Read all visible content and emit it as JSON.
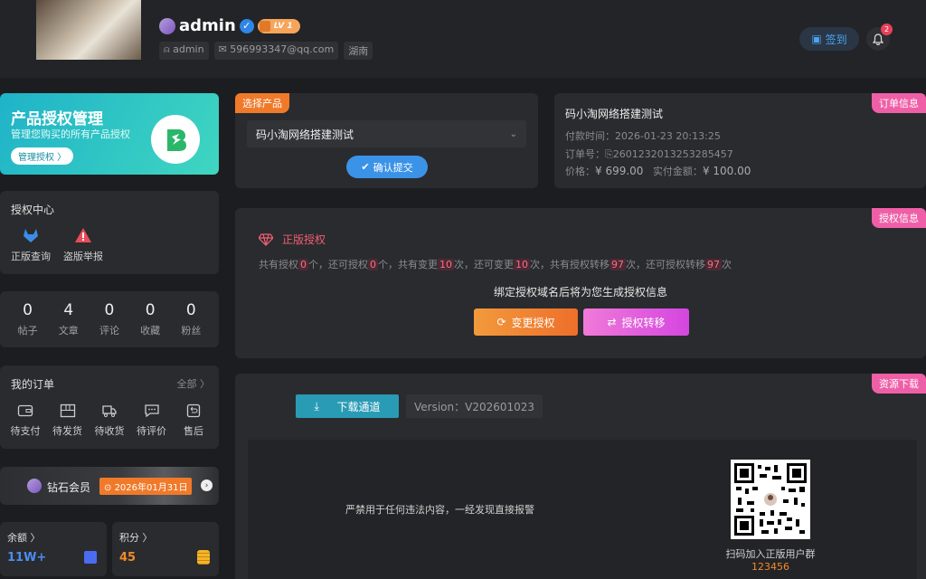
{
  "header": {
    "username": "admin",
    "level": "LV 1",
    "meta_user": "admin",
    "meta_email": "596993347@qq.com",
    "meta_region": "湖南",
    "signin_label": "签到",
    "notif_count": "2"
  },
  "promo": {
    "title": "产品授权管理",
    "subtitle": "管理您购买的所有产品授权",
    "button": "管理授权 〉"
  },
  "center": {
    "title": "授权中心",
    "items": [
      {
        "label": "正版查询",
        "icon": "gitlab-icon",
        "color": "#3b8de8"
      },
      {
        "label": "盗版举报",
        "icon": "warning-icon",
        "color": "#e84c5a"
      }
    ]
  },
  "stats": [
    {
      "value": "0",
      "label": "帖子"
    },
    {
      "value": "4",
      "label": "文章"
    },
    {
      "value": "0",
      "label": "评论"
    },
    {
      "value": "0",
      "label": "收藏"
    },
    {
      "value": "0",
      "label": "粉丝"
    }
  ],
  "orders": {
    "title": "我的订单",
    "all": "全部 〉",
    "items": [
      {
        "label": "待支付",
        "icon": "wallet-icon"
      },
      {
        "label": "待发货",
        "icon": "box-icon"
      },
      {
        "label": "待收货",
        "icon": "truck-icon"
      },
      {
        "label": "待评价",
        "icon": "chat-icon"
      },
      {
        "label": "售后",
        "icon": "return-icon"
      }
    ]
  },
  "vip": {
    "label": "钻石会员",
    "date": "2026年01月31日"
  },
  "balance": {
    "title": "余额 〉",
    "value": "11W+"
  },
  "points": {
    "title": "积分 〉",
    "value": "45"
  },
  "product": {
    "tag": "选择产品",
    "selected": "码小淘网络搭建测试",
    "confirm": "确认提交"
  },
  "order_info": {
    "tag": "订单信息",
    "name": "码小淘网络搭建测试",
    "pay_time_label": "付款时间：",
    "pay_time": "2026-01-23 20:13:25",
    "order_no_label": "订单号：",
    "order_no": "2601232013253285457",
    "price_label": "价格：",
    "price": "¥ 699.00",
    "paid_label": "实付金额：",
    "paid": "¥ 100.00"
  },
  "license": {
    "tag": "授权信息",
    "title": "正版授权",
    "t1": "共有授权",
    "n1": "0",
    "t2": "个，还可授权",
    "n2": "0",
    "t3": "个，共有变更",
    "n3": "10",
    "t4": "次，还可变更",
    "n4": "10",
    "t5": "次，共有授权转移",
    "n5": "97",
    "t6": "次，还可授权转移",
    "n6": "97",
    "t7": "次",
    "notice": "绑定授权域名后将为您生成授权信息",
    "change_btn": "变更授权",
    "transfer_btn": "授权转移"
  },
  "download": {
    "tag": "资源下载",
    "button": "下载通道",
    "version": "Version：V202601023",
    "warning": "严禁用于任何违法内容，一经发现直接报警",
    "qr_caption": "扫码加入正版用户群",
    "qr_number": "123456"
  },
  "colors": {
    "accent": "#3aa3c2",
    "pink": "#ef5fa7",
    "orange": "#f07a2a"
  }
}
